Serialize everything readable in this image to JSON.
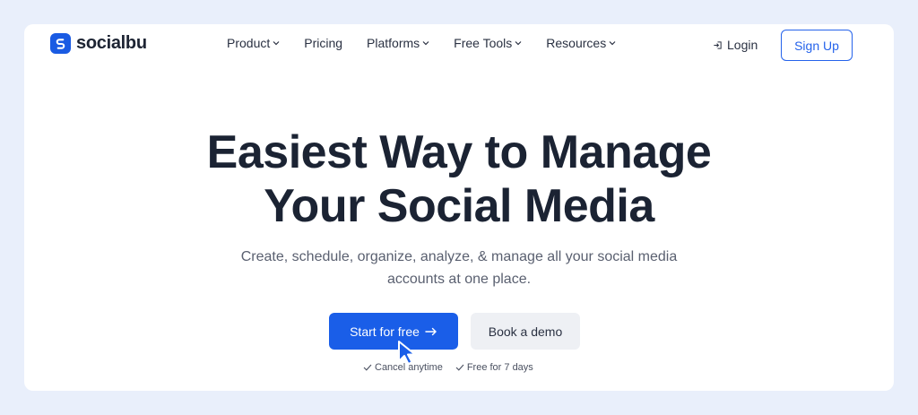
{
  "brand": {
    "name": "socialbu",
    "accent": "#1a5be3"
  },
  "nav": {
    "items": [
      {
        "label": "Product",
        "has_dropdown": true
      },
      {
        "label": "Pricing",
        "has_dropdown": false
      },
      {
        "label": "Platforms",
        "has_dropdown": true
      },
      {
        "label": "Free Tools",
        "has_dropdown": true
      },
      {
        "label": "Resources",
        "has_dropdown": true
      }
    ],
    "login_label": "Login",
    "signup_label": "Sign Up"
  },
  "hero": {
    "title_line1": "Easiest Way to Manage",
    "title_line2": "Your Social Media",
    "subtitle_line1": "Create, schedule, organize, analyze, & manage all your social media",
    "subtitle_line2": "accounts at one place.",
    "primary_cta": "Start for free",
    "secondary_cta": "Book a demo",
    "perks": [
      "Cancel anytime",
      "Free for 7 days"
    ]
  }
}
